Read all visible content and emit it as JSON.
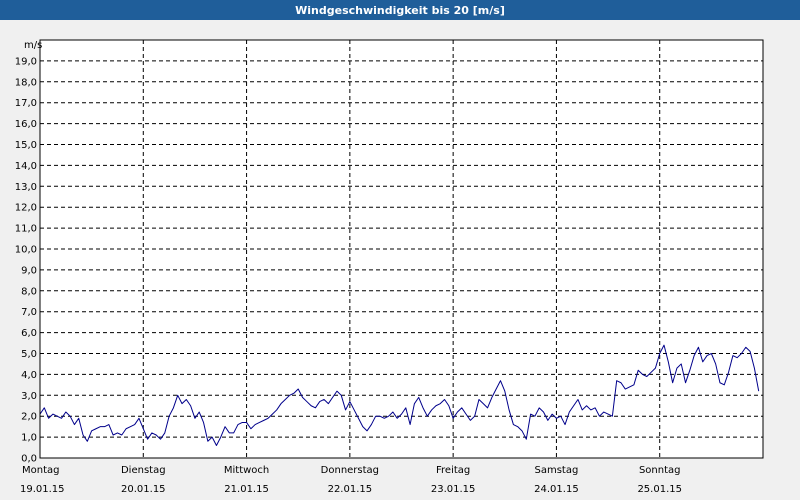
{
  "window": {
    "title": "Windgeschwindigkeit bis 20 [m/s]"
  },
  "chart_data": {
    "type": "line",
    "title": "Windgeschwindigkeit bis 20 [m/s]",
    "ylabel": "m/s",
    "xlabel": "",
    "ylim": [
      0,
      20
    ],
    "xlim_days": [
      0,
      7
    ],
    "grid": true,
    "legend": "none",
    "y_ticks": [
      "0,0",
      "1,0",
      "2,0",
      "3,0",
      "4,0",
      "5,0",
      "6,0",
      "7,0",
      "8,0",
      "9,0",
      "10,0",
      "11,0",
      "12,0",
      "13,0",
      "14,0",
      "15,0",
      "16,0",
      "17,0",
      "18,0",
      "19,0"
    ],
    "x_ticks": [
      {
        "day": "Montag",
        "date": "19.01.15"
      },
      {
        "day": "Dienstag",
        "date": "20.01.15"
      },
      {
        "day": "Mittwoch",
        "date": "21.01.15"
      },
      {
        "day": "Donnerstag",
        "date": "22.01.15"
      },
      {
        "day": "Freitag",
        "date": "23.01.15"
      },
      {
        "day": "Samstag",
        "date": "24.01.15"
      },
      {
        "day": "Sonntag",
        "date": "25.01.15"
      }
    ],
    "line_color": "#00008b",
    "series": [
      {
        "x": [
          "19.01.15 00:00",
          "19.01.15 01:00",
          "19.01.15 02:00",
          "19.01.15 03:00",
          "19.01.15 04:00",
          "19.01.15 05:00",
          "19.01.15 06:00",
          "19.01.15 07:00",
          "19.01.15 08:00",
          "19.01.15 09:00",
          "19.01.15 10:00",
          "19.01.15 11:00",
          "19.01.15 12:00",
          "19.01.15 13:00",
          "19.01.15 14:00",
          "19.01.15 15:00",
          "19.01.15 16:00",
          "19.01.15 17:00",
          "19.01.15 18:00",
          "19.01.15 19:00",
          "19.01.15 20:00",
          "19.01.15 21:00",
          "19.01.15 22:00",
          "19.01.15 23:00",
          "20.01.15 00:00",
          "20.01.15 01:00",
          "20.01.15 02:00",
          "20.01.15 03:00",
          "20.01.15 04:00",
          "20.01.15 05:00",
          "20.01.15 06:00",
          "20.01.15 07:00",
          "20.01.15 08:00",
          "20.01.15 09:00",
          "20.01.15 10:00",
          "20.01.15 11:00",
          "20.01.15 12:00",
          "20.01.15 13:00",
          "20.01.15 14:00",
          "20.01.15 15:00",
          "20.01.15 16:00",
          "20.01.15 17:00",
          "20.01.15 18:00",
          "20.01.15 19:00",
          "20.01.15 20:00",
          "20.01.15 21:00",
          "20.01.15 22:00",
          "20.01.15 23:00",
          "21.01.15 00:00",
          "21.01.15 01:00",
          "21.01.15 02:00",
          "21.01.15 03:00",
          "21.01.15 04:00",
          "21.01.15 05:00",
          "21.01.15 06:00",
          "21.01.15 07:00",
          "21.01.15 08:00",
          "21.01.15 09:00",
          "21.01.15 10:00",
          "21.01.15 11:00",
          "21.01.15 12:00",
          "21.01.15 13:00",
          "21.01.15 14:00",
          "21.01.15 15:00",
          "21.01.15 16:00",
          "21.01.15 17:00",
          "21.01.15 18:00",
          "21.01.15 19:00",
          "21.01.15 20:00",
          "21.01.15 21:00",
          "21.01.15 22:00",
          "21.01.15 23:00",
          "22.01.15 00:00",
          "22.01.15 01:00",
          "22.01.15 02:00",
          "22.01.15 03:00",
          "22.01.15 04:00",
          "22.01.15 05:00",
          "22.01.15 06:00",
          "22.01.15 07:00",
          "22.01.15 08:00",
          "22.01.15 09:00",
          "22.01.15 10:00",
          "22.01.15 11:00",
          "22.01.15 12:00",
          "22.01.15 13:00",
          "22.01.15 14:00",
          "22.01.15 15:00",
          "22.01.15 16:00",
          "22.01.15 17:00",
          "22.01.15 18:00",
          "22.01.15 19:00",
          "22.01.15 20:00",
          "22.01.15 21:00",
          "22.01.15 22:00",
          "22.01.15 23:00",
          "23.01.15 00:00",
          "23.01.15 01:00",
          "23.01.15 02:00",
          "23.01.15 03:00",
          "23.01.15 04:00",
          "23.01.15 05:00",
          "23.01.15 06:00",
          "23.01.15 07:00",
          "23.01.15 08:00",
          "23.01.15 09:00",
          "23.01.15 10:00",
          "23.01.15 11:00",
          "23.01.15 12:00",
          "23.01.15 13:00",
          "23.01.15 14:00",
          "23.01.15 15:00",
          "23.01.15 16:00",
          "23.01.15 17:00",
          "23.01.15 18:00",
          "23.01.15 19:00",
          "23.01.15 20:00",
          "23.01.15 21:00",
          "23.01.15 22:00",
          "23.01.15 23:00",
          "24.01.15 00:00",
          "24.01.15 01:00",
          "24.01.15 02:00",
          "24.01.15 03:00",
          "24.01.15 04:00",
          "24.01.15 05:00",
          "24.01.15 06:00",
          "24.01.15 07:00",
          "24.01.15 08:00",
          "24.01.15 09:00",
          "24.01.15 10:00",
          "24.01.15 11:00",
          "24.01.15 12:00",
          "24.01.15 13:00",
          "24.01.15 14:00",
          "24.01.15 15:00",
          "24.01.15 16:00",
          "24.01.15 17:00",
          "24.01.15 18:00",
          "24.01.15 19:00",
          "24.01.15 20:00",
          "24.01.15 21:00",
          "24.01.15 22:00",
          "24.01.15 23:00",
          "25.01.15 00:00",
          "25.01.15 01:00",
          "25.01.15 02:00",
          "25.01.15 03:00",
          "25.01.15 04:00",
          "25.01.15 05:00",
          "25.01.15 06:00",
          "25.01.15 07:00",
          "25.01.15 08:00",
          "25.01.15 09:00",
          "25.01.15 10:00",
          "25.01.15 11:00",
          "25.01.15 12:00",
          "25.01.15 13:00",
          "25.01.15 14:00",
          "25.01.15 15:00",
          "25.01.15 16:00",
          "25.01.15 17:00",
          "25.01.15 18:00",
          "25.01.15 19:00",
          "25.01.15 20:00",
          "25.01.15 21:00",
          "25.01.15 22:00",
          "25.01.15 23:00"
        ],
        "values": [
          2.1,
          2.4,
          1.9,
          2.1,
          2.0,
          1.9,
          2.2,
          2.0,
          1.6,
          1.9,
          1.1,
          0.8,
          1.3,
          1.4,
          1.5,
          1.5,
          1.6,
          1.1,
          1.2,
          1.1,
          1.4,
          1.5,
          1.6,
          1.9,
          1.4,
          0.9,
          1.2,
          1.1,
          0.9,
          1.2,
          2.0,
          2.4,
          3.0,
          2.6,
          2.8,
          2.5,
          1.9,
          2.2,
          1.7,
          0.8,
          1.0,
          0.6,
          1.0,
          1.5,
          1.2,
          1.2,
          1.6,
          1.7,
          1.7,
          1.4,
          1.6,
          1.7,
          1.8,
          1.9,
          2.1,
          2.3,
          2.6,
          2.8,
          3.0,
          3.1,
          3.3,
          2.9,
          2.7,
          2.5,
          2.4,
          2.7,
          2.8,
          2.6,
          2.9,
          3.2,
          3.0,
          2.3,
          2.7,
          2.3,
          1.9,
          1.5,
          1.3,
          1.6,
          2.0,
          2.0,
          1.9,
          2.0,
          2.2,
          1.9,
          2.1,
          2.4,
          1.6,
          2.6,
          2.9,
          2.4,
          2.0,
          2.3,
          2.5,
          2.6,
          2.8,
          2.5,
          1.9,
          2.2,
          2.4,
          2.1,
          1.8,
          2.0,
          2.8,
          2.6,
          2.4,
          2.9,
          3.3,
          3.7,
          3.2,
          2.3,
          1.6,
          1.5,
          1.3,
          0.9,
          2.1,
          2.0,
          2.4,
          2.2,
          1.8,
          2.1,
          1.9,
          2.0,
          1.6,
          2.2,
          2.5,
          2.8,
          2.3,
          2.5,
          2.3,
          2.4,
          2.0,
          2.2,
          2.1,
          2.0,
          3.7,
          3.6,
          3.3,
          3.4,
          3.5,
          4.2,
          4.0,
          3.9,
          4.1,
          4.3,
          5.0,
          5.4,
          4.6,
          3.6,
          4.3,
          4.5,
          3.6,
          4.2,
          4.9,
          5.3,
          4.6,
          4.9,
          5.0,
          4.5,
          3.6,
          3.5,
          4.1,
          4.9,
          4.8,
          5.0,
          5.3,
          5.1,
          4.3,
          3.2
        ]
      }
    ]
  }
}
